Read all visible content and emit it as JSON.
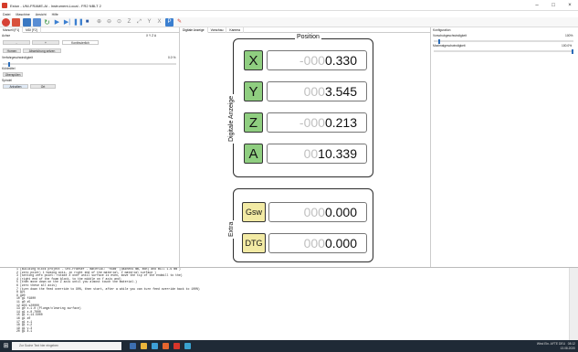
{
  "window": {
    "title": "Estun - UNI-FRAME-AI - Instrument-Local - FR2 NBLT 2"
  },
  "menu": [
    "Datei",
    "Maschine",
    "Ansicht",
    "Hilfe"
  ],
  "left_panel": {
    "tabs": [
      "Manuell [F1]",
      "MDI [F2]"
    ],
    "section_label": "Achse",
    "axis_options": "X  Y  Z  A",
    "minus_label": "-",
    "plus_label": "+",
    "continuous_label": "Kontinuierlich",
    "home_button": "Homen",
    "touch_button": "Abweichung setzen",
    "jog_speed_label": "Verfahrgeschwindigkeit",
    "jog_speed_value": "0.0 %",
    "jog_speed_fraction": 0.03,
    "spindle_label": "Kühlmittel",
    "coolant_button": "Überspülen",
    "spindle2_label": "Spindel",
    "spindle_on_button": "Anhalten",
    "spindle_off_button": "Ort"
  },
  "center": {
    "tabs": [
      "Digitale Anzeige",
      "Vorschau",
      "Kamera"
    ],
    "position_title": "Position",
    "position_side_label": "Digitale Anzeige",
    "axes": [
      {
        "name": "X",
        "lead": "-000",
        "main": "0.330"
      },
      {
        "name": "Y",
        "lead": "000",
        "main": "3.545"
      },
      {
        "name": "Z",
        "lead": "-000",
        "main": "0.213"
      },
      {
        "name": "A",
        "lead": "00",
        "main": "10.339"
      }
    ],
    "extra_side_label": "Extra",
    "extras": [
      {
        "name": "Gsw",
        "lead": "000",
        "main": "0.000"
      },
      {
        "name": "DTG",
        "lead": "000",
        "main": "0.000"
      }
    ]
  },
  "right_panel": {
    "header": "Konfiguration",
    "feed_label": "Vorschubgeschwindigkeit",
    "feed_value": "100%",
    "feed_fraction": 0.03,
    "max_label": "Maximalgeschwindigkeit",
    "max_value": "100.0%",
    "max_fraction": 1.0
  },
  "log_lines": [
    "1  (Building block project - Unt-Fraeser - material: 'foam' (dazhe04 mm, mon) and mill 1.6 mm )",
    "2  (zero point) 1 homing axis, in right end of the material, Z material surface )",
    "3  (setting zero point: rotate X over until surface is even, move the tip of the endmill to the)",
    "4  (right end of the foam block, to the middle on Y axis and)",
    "5  (then move down on the Z axis until you almost touch the material.)",
    "6  (zero these all axis)",
    "7  (turn down the feed override to 90%, then start, after a while you can turn feed override back to 100%)",
    "8  g21",
    "9  g90",
    "10 g1 f1800",
    "11 g0 z5",
    "12 m03 s20000",
    "13 g0 x-1.0 (Plunge/clearing surface)",
    "14 g1 z-0.7000",
    "15 g1 x-14.5000",
    "16 g1 z0",
    "17 g1 z-1",
    "18 g1 x-2",
    "19 g1 y-3",
    "20 g1 z-1"
  ],
  "taskbar": {
    "search_placeholder": "Zur Suche Text hier eingeben",
    "tray_time": "08:12",
    "tray_date": "13.08.2020",
    "tray_text": "Wind Ein. AFTE DEU"
  }
}
